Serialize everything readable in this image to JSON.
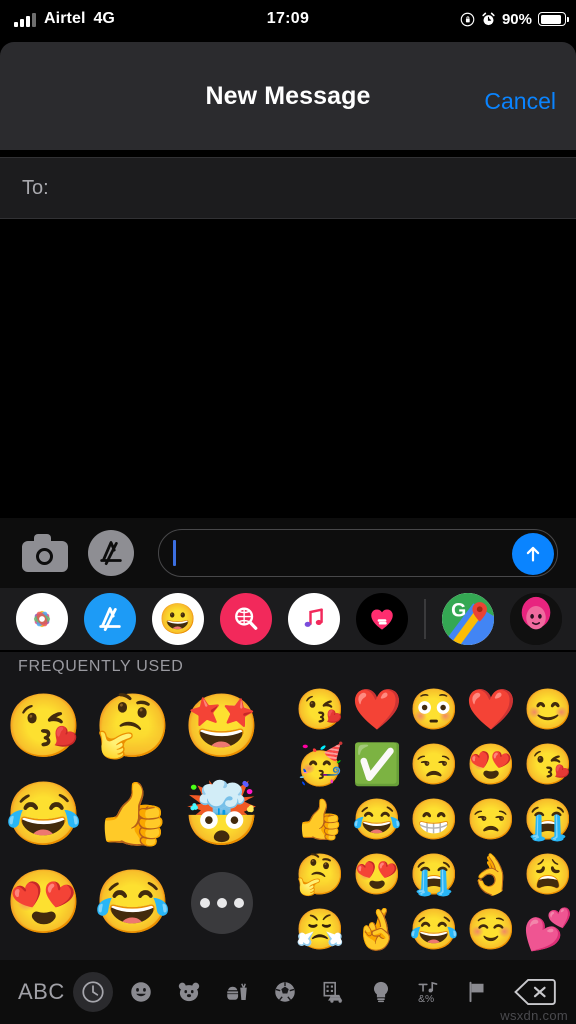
{
  "status_bar": {
    "carrier": "Airtel",
    "network": "4G",
    "time": "17:09",
    "battery_percent": "90%",
    "battery_level": 90,
    "signal_bars_filled": 3,
    "signal_bars_total": 4,
    "icons": [
      "rotation-lock-icon",
      "alarm-clock-icon",
      "battery-icon"
    ]
  },
  "header": {
    "title": "New Message",
    "cancel_label": "Cancel"
  },
  "recipients": {
    "to_label": "To:",
    "value": "",
    "placeholder": ""
  },
  "compose": {
    "camera_icon": "camera-icon",
    "appstore_icon": "app-store-icon",
    "message_value": "",
    "message_placeholder": "",
    "send_icon": "send-arrow-up-icon",
    "cursor_visible": true
  },
  "app_drawer": {
    "apps": [
      {
        "name": "photos",
        "label": "Photos",
        "icon": "photos-icon"
      },
      {
        "name": "app-store",
        "label": "App Store",
        "icon": "app-store-icon"
      },
      {
        "name": "memoji-stickers",
        "label": "Memoji Stickers",
        "icon": "memoji-stickers-icon"
      },
      {
        "name": "images",
        "label": "#images",
        "icon": "images-search-icon"
      },
      {
        "name": "music",
        "label": "Music",
        "icon": "apple-music-icon"
      },
      {
        "name": "digital-touch",
        "label": "Digital Touch",
        "icon": "digital-touch-heart-icon"
      },
      {
        "name": "google-maps",
        "label": "Google Maps",
        "icon": "google-maps-icon"
      },
      {
        "name": "memoji-pink",
        "label": "Memoji",
        "icon": "memoji-pink-icon"
      }
    ]
  },
  "sticker_panel": {
    "section_title": "FREQUENTLY USED",
    "memoji": [
      {
        "name": "memoji-wink-kiss-heart",
        "glyph": "😘"
      },
      {
        "name": "memoji-thinking",
        "glyph": "🤔"
      },
      {
        "name": "memoji-star-struck",
        "glyph": "🤩"
      },
      {
        "name": "memoji-laughing-tears",
        "glyph": "😂"
      },
      {
        "name": "memoji-thumbs-up",
        "glyph": "👍"
      },
      {
        "name": "memoji-mind-blown",
        "glyph": "🤯"
      },
      {
        "name": "memoji-heart-eyes",
        "glyph": "😍"
      },
      {
        "name": "memoji-laughing-tears-2",
        "glyph": "😂"
      }
    ],
    "more_button": {
      "name": "more-stickers-button",
      "label": "•••"
    },
    "emoji_rows": [
      [
        "😘",
        "❤️",
        "😳",
        "❤️",
        "😊"
      ],
      [
        "🥳",
        "✅",
        "😒",
        "😍",
        "😘"
      ],
      [
        "👍",
        "😂",
        "😁",
        "😒",
        "😭"
      ],
      [
        "🤔",
        "😍",
        "😭",
        "👌",
        "😩"
      ],
      [
        "😤",
        "🤞",
        "😂",
        "☺️",
        "💕"
      ]
    ]
  },
  "keyboard_toolbar": {
    "abc_label": "ABC",
    "categories": [
      {
        "name": "recents",
        "icon": "clock-icon",
        "glyph": "",
        "active": true
      },
      {
        "name": "smileys-people",
        "icon": "smiley-icon",
        "glyph": "😀",
        "active": false
      },
      {
        "name": "animals-nature",
        "icon": "bear-icon",
        "glyph": "🐻",
        "active": false
      },
      {
        "name": "food-drink",
        "icon": "food-icon",
        "glyph": "🍔",
        "active": false
      },
      {
        "name": "activity",
        "icon": "soccer-ball-icon",
        "glyph": "⚽",
        "active": false
      },
      {
        "name": "travel-places",
        "icon": "car-building-icon",
        "glyph": "🚗",
        "active": false
      },
      {
        "name": "objects",
        "icon": "lightbulb-icon",
        "glyph": "💡",
        "active": false
      },
      {
        "name": "symbols",
        "icon": "symbols-icon",
        "glyph": "",
        "active": false
      },
      {
        "name": "flags",
        "icon": "flag-icon",
        "glyph": "🏳️",
        "active": false
      }
    ],
    "delete_icon": "delete-backspace-icon"
  },
  "watermark": {
    "text": "wsxdn.com"
  },
  "colors": {
    "accent_blue": "#0a84ff",
    "header_bg": "#2b2b2e",
    "panel_bg": "#161618",
    "drawer_bg": "#1c1c1e",
    "body_bg": "#000000",
    "secondary_text": "#a8a8ad"
  }
}
